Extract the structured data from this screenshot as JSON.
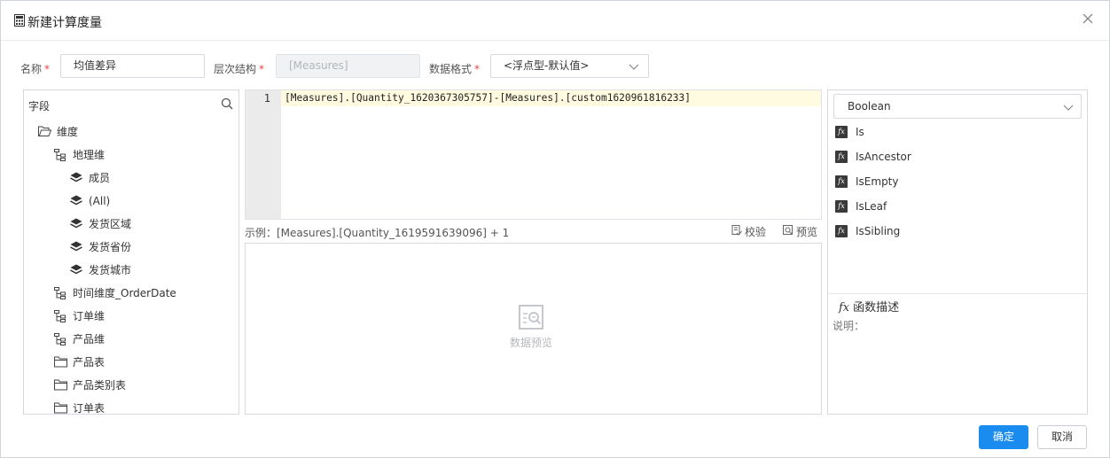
{
  "dialog": {
    "title": "新建计算度量",
    "close_icon": "close-icon",
    "calculator_icon": "calculator-icon"
  },
  "form": {
    "name_label": "名称",
    "name_value": "均值差异",
    "hierarchy_label": "层次结构",
    "hierarchy_value": "[Measures]",
    "format_label": "数据格式",
    "format_value": "<浮点型-默认值>",
    "required_mark": "*"
  },
  "fields": {
    "header": "字段",
    "items": [
      {
        "label": "维度",
        "icon": "folder-open-icon"
      },
      {
        "label": "地理维",
        "icon": "hierarchy-icon"
      },
      {
        "label": "成员",
        "icon": "layers-icon"
      },
      {
        "label": "(All)",
        "icon": "layers-icon"
      },
      {
        "label": "发货区域",
        "icon": "layers-icon"
      },
      {
        "label": "发货省份",
        "icon": "layers-icon"
      },
      {
        "label": "发货城市",
        "icon": "layers-icon"
      },
      {
        "label": "时间维度_OrderDate",
        "icon": "hierarchy-icon"
      },
      {
        "label": "订单维",
        "icon": "hierarchy-icon"
      },
      {
        "label": "产品维",
        "icon": "hierarchy-icon"
      },
      {
        "label": "产品表",
        "icon": "folder-icon"
      },
      {
        "label": "产品类别表",
        "icon": "folder-icon"
      },
      {
        "label": "订单表",
        "icon": "folder-icon"
      }
    ]
  },
  "editor": {
    "line_number": "1",
    "code": "[Measures].[Quantity_1620367305757]-[Measures].[custom1620961816233]"
  },
  "example": {
    "text": "示例：[Measures].[Quantity_1619591639096] + 1",
    "validate_label": "校验",
    "preview_label": "预览"
  },
  "preview": {
    "placeholder": "数据预览"
  },
  "functions": {
    "category": "Boolean",
    "items": [
      "Is",
      "IsAncestor",
      "IsEmpty",
      "IsLeaf",
      "IsSibling"
    ],
    "desc_title": "函数描述",
    "desc_body": "说明："
  },
  "buttons": {
    "confirm": "确定",
    "cancel": "取消"
  },
  "colors": {
    "primary": "#1a8cf0",
    "required": "#e64545",
    "editor_line_highlight": "#fffbe0",
    "gutter": "#ebebeb"
  }
}
